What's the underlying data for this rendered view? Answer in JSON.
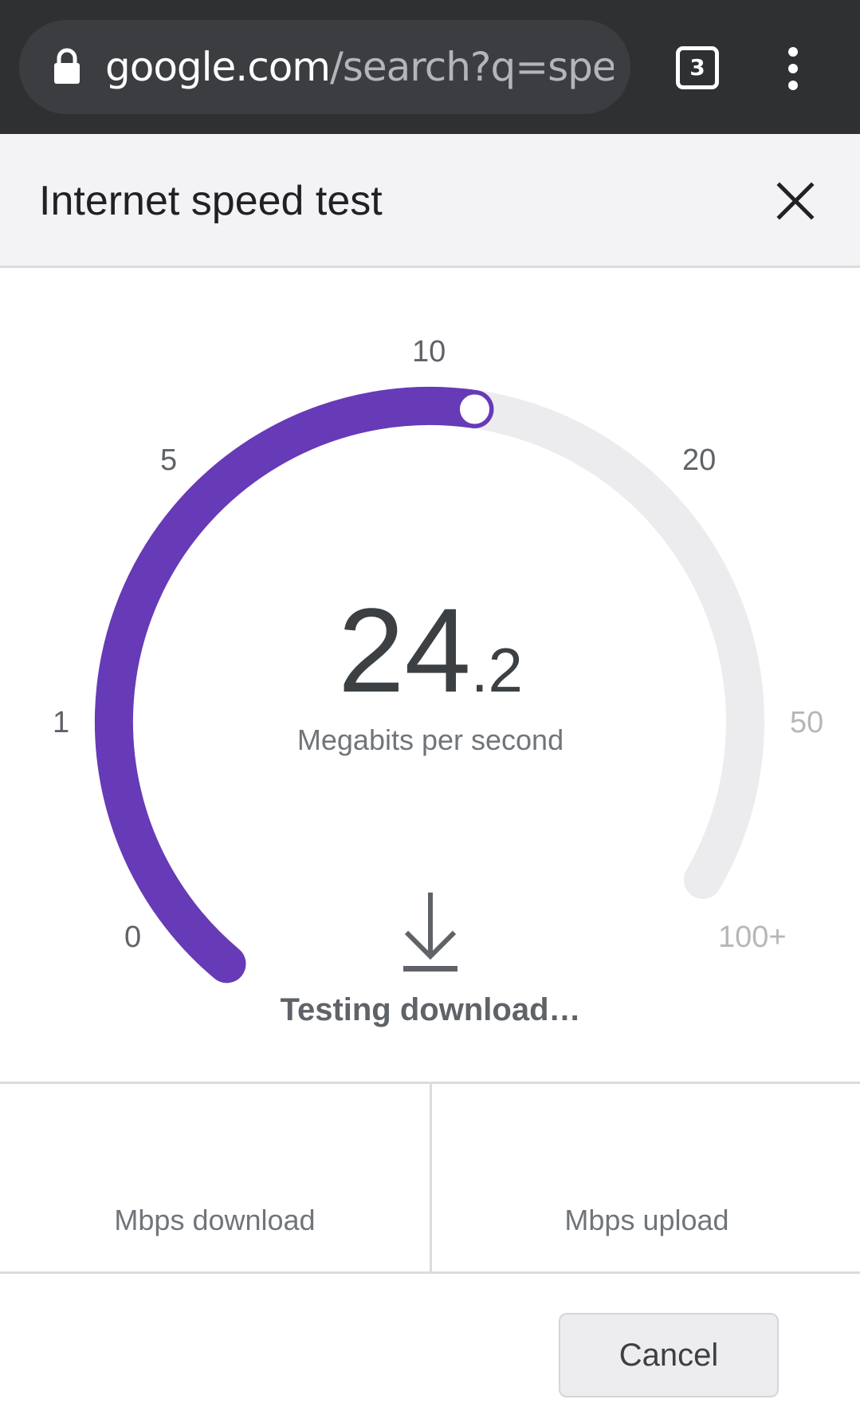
{
  "browser": {
    "url_host": "google.com",
    "url_path": "/search?q=spe",
    "tab_count": "3",
    "icons": [
      "lock-icon",
      "tabs-icon",
      "overflow-menu-icon"
    ]
  },
  "dialog": {
    "title": "Internet speed test",
    "close_icon": "close-icon"
  },
  "gauge": {
    "ticks": [
      "0",
      "1",
      "5",
      "10",
      "20",
      "50",
      "100+"
    ],
    "progress_fraction": 0.57,
    "value_int": "24",
    "value_frac": ".2",
    "unit": "Megabits per second",
    "status_icon": "download-arrow-icon",
    "status": "Testing download…",
    "colors": {
      "progress": "#673ab7",
      "track": "#ececee",
      "tick_active": "#5f6368",
      "tick_inactive": "#b6b7ba"
    }
  },
  "results": {
    "download_label": "Mbps download",
    "upload_label": "Mbps upload"
  },
  "actions": {
    "cancel_label": "Cancel"
  }
}
